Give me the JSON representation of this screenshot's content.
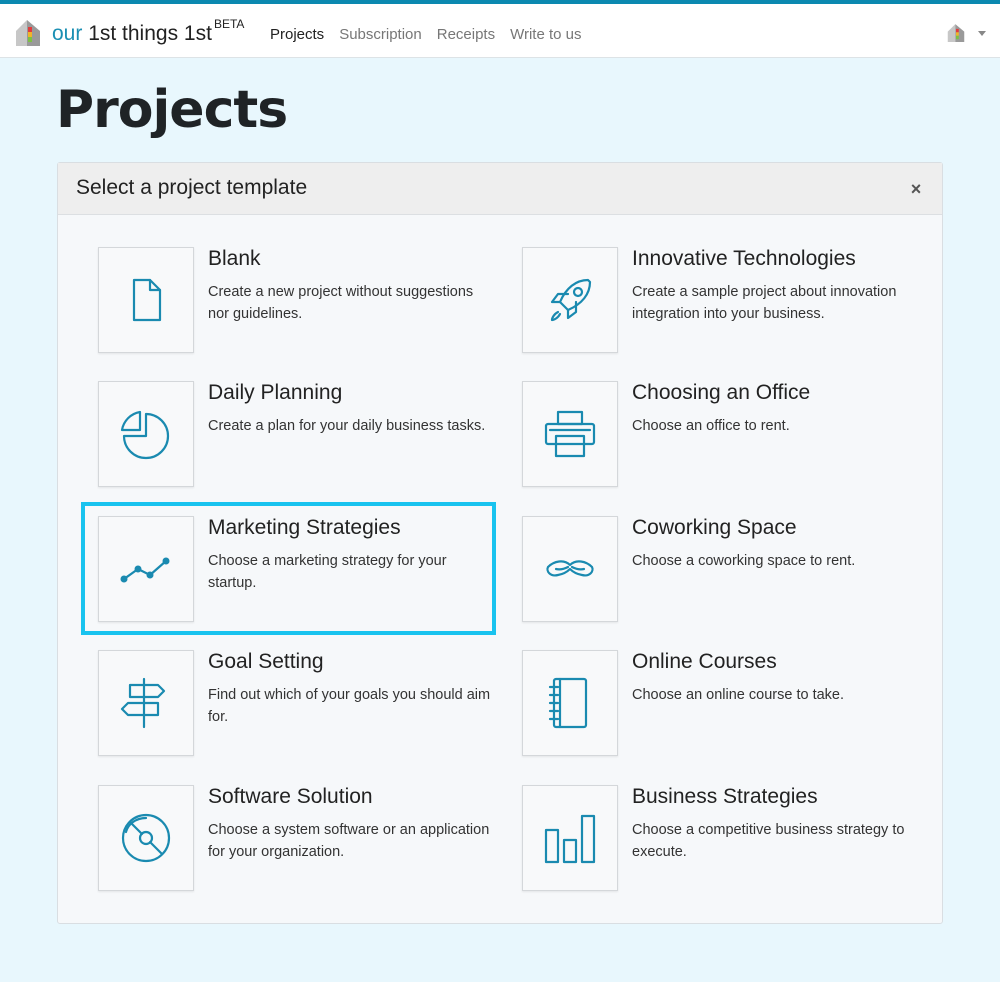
{
  "app": {
    "brand_our": "our",
    "brand_rest": " 1st things 1st",
    "brand_badge": "BETA"
  },
  "nav": [
    {
      "label": "Projects",
      "active": true
    },
    {
      "label": "Subscription",
      "active": false
    },
    {
      "label": "Receipts",
      "active": false
    },
    {
      "label": "Write to us",
      "active": false
    }
  ],
  "page": {
    "title": "Projects"
  },
  "dialog": {
    "title": "Select a project template",
    "close_label": "×"
  },
  "templates": [
    {
      "name": "Blank",
      "description": "Create a new project without suggestions nor guidelines.",
      "icon": "file-icon"
    },
    {
      "name": "Innovative Technologies",
      "description": "Create a sample project about innovation integration into your business.",
      "icon": "rocket-icon"
    },
    {
      "name": "Daily Planning",
      "description": "Create a plan for your daily business tasks.",
      "icon": "pie-chart-icon"
    },
    {
      "name": "Choosing an Office",
      "description": "Choose an office to rent.",
      "icon": "printer-icon"
    },
    {
      "name": "Marketing Strategies",
      "description": "Choose a marketing strategy for your startup.",
      "icon": "line-chart-icon"
    },
    {
      "name": "Coworking Space",
      "description": "Choose a coworking space to rent.",
      "icon": "mustache-icon"
    },
    {
      "name": "Goal Setting",
      "description": "Find out which of your goals you should aim for.",
      "icon": "signpost-icon"
    },
    {
      "name": "Online Courses",
      "description": "Choose an online course to take.",
      "icon": "notebook-icon"
    },
    {
      "name": "Software Solution",
      "description": "Choose a system software or an application for your organization.",
      "icon": "disc-icon"
    },
    {
      "name": "Business Strategies",
      "description": "Choose a competitive business strategy to execute.",
      "icon": "bar-chart-icon"
    }
  ],
  "colors": {
    "accent": "#1a8ab0",
    "highlight": "#19c3ef",
    "background": "#e8f7fd"
  }
}
